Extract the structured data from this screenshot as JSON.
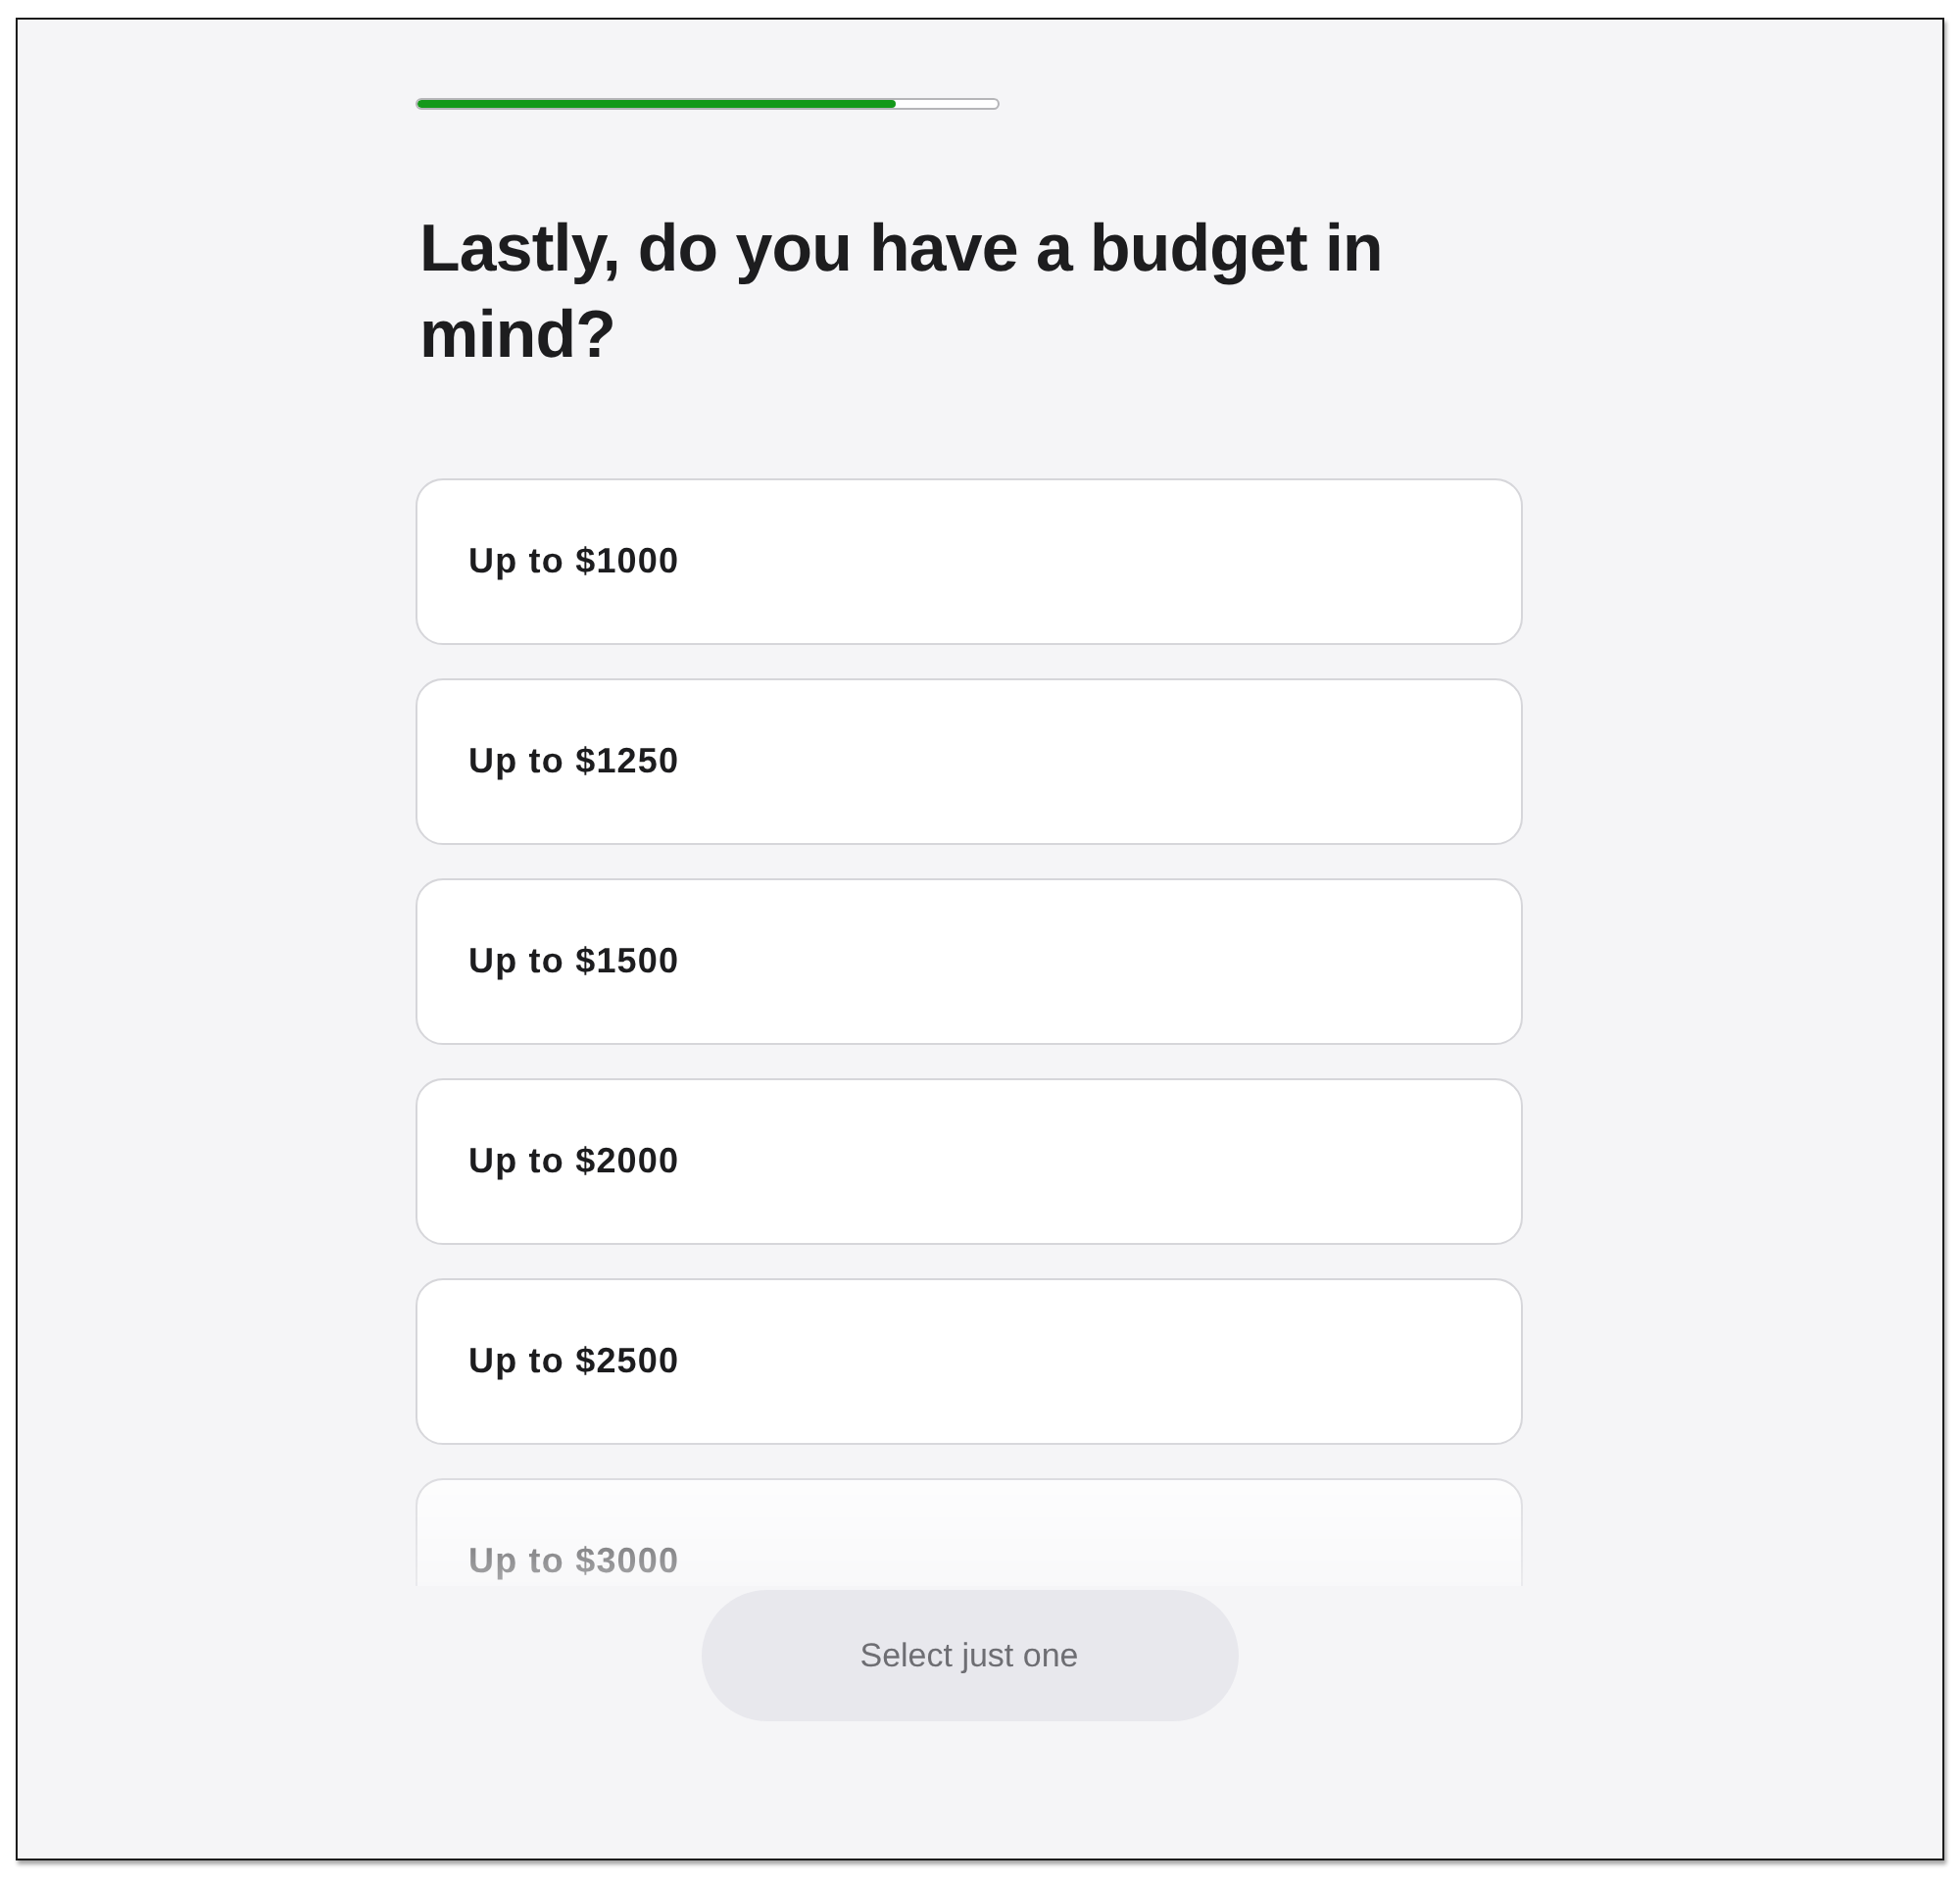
{
  "progress": {
    "level": 0.825
  },
  "question": "Lastly, do you have a budget in mind?",
  "options": [
    {
      "label": "Up to $1000",
      "selected": false
    },
    {
      "label": "Up to $1250",
      "selected": false
    },
    {
      "label": "Up to $1500",
      "selected": false
    },
    {
      "label": "Up to $2000",
      "selected": false
    },
    {
      "label": "Up to $2500",
      "selected": false
    },
    {
      "label": "Up to $3000",
      "selected": false
    }
  ],
  "button": {
    "label": "Select just one",
    "disabled": true
  }
}
